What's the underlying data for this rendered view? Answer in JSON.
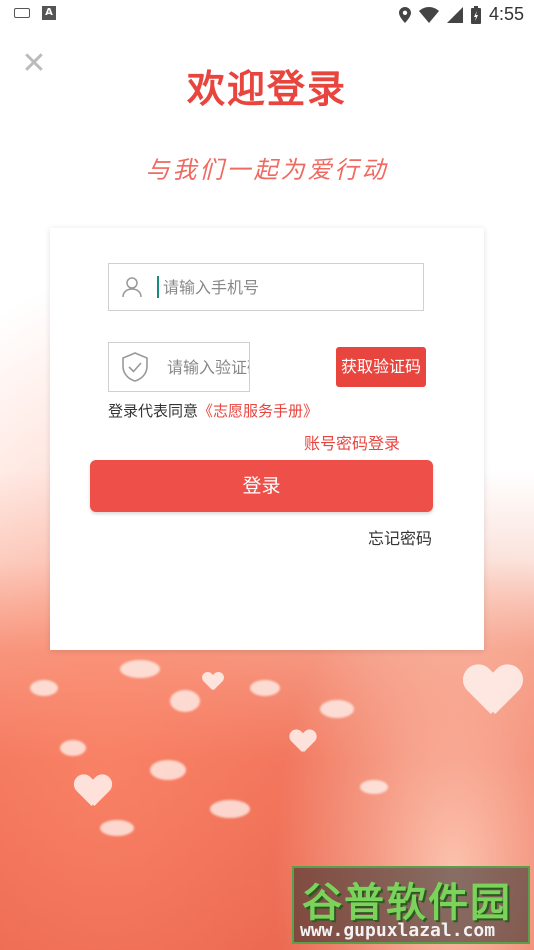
{
  "status_bar": {
    "time": "4:55"
  },
  "header": {
    "title": "欢迎登录",
    "slogan": "与我们一起为爱行动"
  },
  "form": {
    "phone_placeholder": "请输入手机号",
    "code_placeholder": "请输入验证码",
    "get_code_label": "获取验证码",
    "agree_prefix": "登录代表同意",
    "agree_link": "《志愿服务手册》",
    "account_login_label": "账号密码登录",
    "login_label": "登录",
    "forgot_label": "忘记密码"
  },
  "watermark": {
    "cn": "谷普软件园",
    "en": "www.gupuxlazal.com"
  },
  "colors": {
    "accent": "#e8453f",
    "button": "#ee5049"
  }
}
